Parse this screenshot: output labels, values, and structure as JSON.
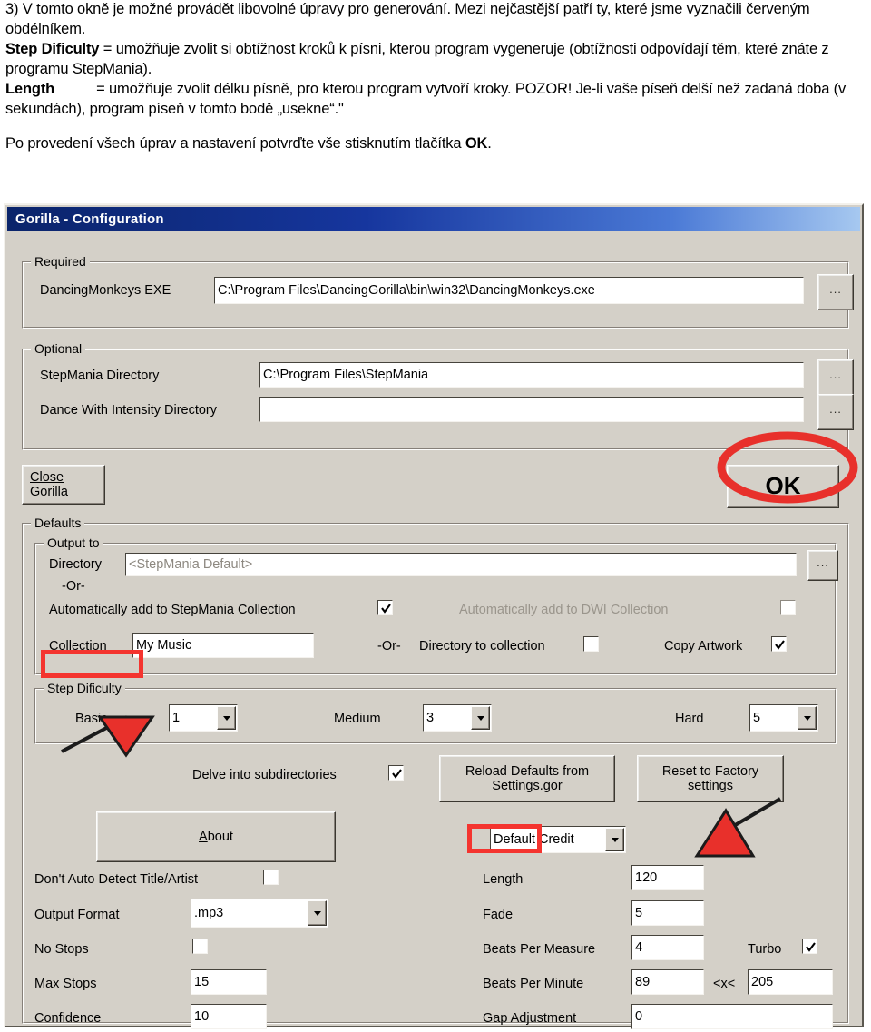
{
  "document_text": {
    "p1_part1": "3) V tomto okně je možné provádět libovolné úpravy pro generování. Mezi nejčastější patří ty, které jsme vyznačili červeným obdélníkem.",
    "p2_term": "Step Dificulty",
    "p2_body": "= umožňuje zvolit si obtížnost kroků k písni, kterou program vygeneruje (obtížnosti odpovídají těm, které znáte z programu StepMania).",
    "p3_term": "Length",
    "p3_body": "= umožňuje zvolit délku písně, pro kterou program vytvoří kroky. POZOR! Je-li vaše píseň delší než zadaná doba (v sekundách), program píseň v tomto bodě „usekne“.\"",
    "p4_pre": "Po provedení všech úprav a nastavení potvrďte vše stisknutím tlačítka ",
    "p4_bold": "OK",
    "p4_post": "."
  },
  "dialog": {
    "title": "Gorilla - Configuration",
    "required": {
      "caption": "Required",
      "exe_label": "DancingMonkeys EXE",
      "exe_value": "C:\\Program Files\\DancingGorilla\\bin\\win32\\DancingMonkeys.exe",
      "browse_label": "..."
    },
    "optional": {
      "caption": "Optional",
      "stepmania_label": "StepMania Directory",
      "stepmania_value": "C:\\Program Files\\StepMania",
      "stepmania_browse": "...",
      "dwi_label": "Dance With Intensity Directory",
      "dwi_value": "",
      "dwi_browse": "..."
    },
    "close_button": {
      "line1": "Close",
      "line2": "Gorilla",
      "accesskey": "C"
    },
    "ok_button": {
      "label": "OK",
      "accesskey": "O"
    },
    "defaults": {
      "caption": "Defaults",
      "output_to": {
        "caption": "Output to",
        "directory_label": "Directory",
        "directory_value": "<StepMania Default>",
        "directory_browse": "...",
        "or_1": "-Or-",
        "auto_stepmania_label": "Automatically add to StepMania Collection",
        "auto_stepmania_checked": true,
        "auto_dwi_label": "Automatically add to DWI Collection",
        "auto_dwi_checked": false,
        "collection_label": "Collection",
        "collection_value": "My Music",
        "or_2": "-Or-",
        "dir_to_collection_label": "Directory to collection",
        "dir_to_collection_checked": false,
        "copy_artwork_label": "Copy Artwork",
        "copy_artwork_checked": true
      },
      "step_difficulty": {
        "caption": "Step Dificulty",
        "basic_label": "Basic",
        "basic_value": "1",
        "medium_label": "Medium",
        "medium_value": "3",
        "hard_label": "Hard",
        "hard_value": "5"
      },
      "delve_label": "Delve into subdirectories",
      "delve_checked": true,
      "reload_button": {
        "line1": "Reload Defaults from",
        "line2": "Settings.gor"
      },
      "reset_button": {
        "line1": "Reset to Factory",
        "line2": "settings"
      },
      "about_button": {
        "label": "About",
        "accesskey": "A"
      },
      "credit_combo_value": "Default Credit",
      "no_autodetect_label": "Don't Auto Detect Title/Artist",
      "no_autodetect_checked": false,
      "length_label": "Length",
      "length_value": "120",
      "output_format_label": "Output Format",
      "output_format_value": ".mp3",
      "fade_label": "Fade",
      "fade_value": "5",
      "no_stops_label": "No Stops",
      "no_stops_checked": false,
      "beats_per_measure_label": "Beats Per Measure",
      "beats_per_measure_value": "4",
      "turbo_label": "Turbo",
      "turbo_checked": true,
      "max_stops_label": "Max Stops",
      "max_stops_value": "15",
      "beats_per_minute_label": "Beats Per Minute",
      "bpm_min_value": "89",
      "bpm_separator": "<x<",
      "bpm_max_value": "205",
      "confidence_label": "Confidence",
      "confidence_value": "10",
      "gap_adjustment_label": "Gap Adjustment",
      "gap_adjustment_value": "0"
    }
  },
  "annotations": {
    "accent_red": "#f4342f",
    "ok_circle": "red-ellipse-around-ok-button",
    "step_difficulty_box": "red-rectangle-around-step-dificulty",
    "length_box": "red-rectangle-around-length",
    "arrow_step_difficulty": "red-arrow-pointing-to-basic-dropdown",
    "arrow_length": "red-arrow-pointing-to-length-value"
  },
  "theme": {
    "title_bar_start": "#0a246a",
    "title_bar_end": "#a6c8f0",
    "dialog_face": "#d4d0c8"
  }
}
